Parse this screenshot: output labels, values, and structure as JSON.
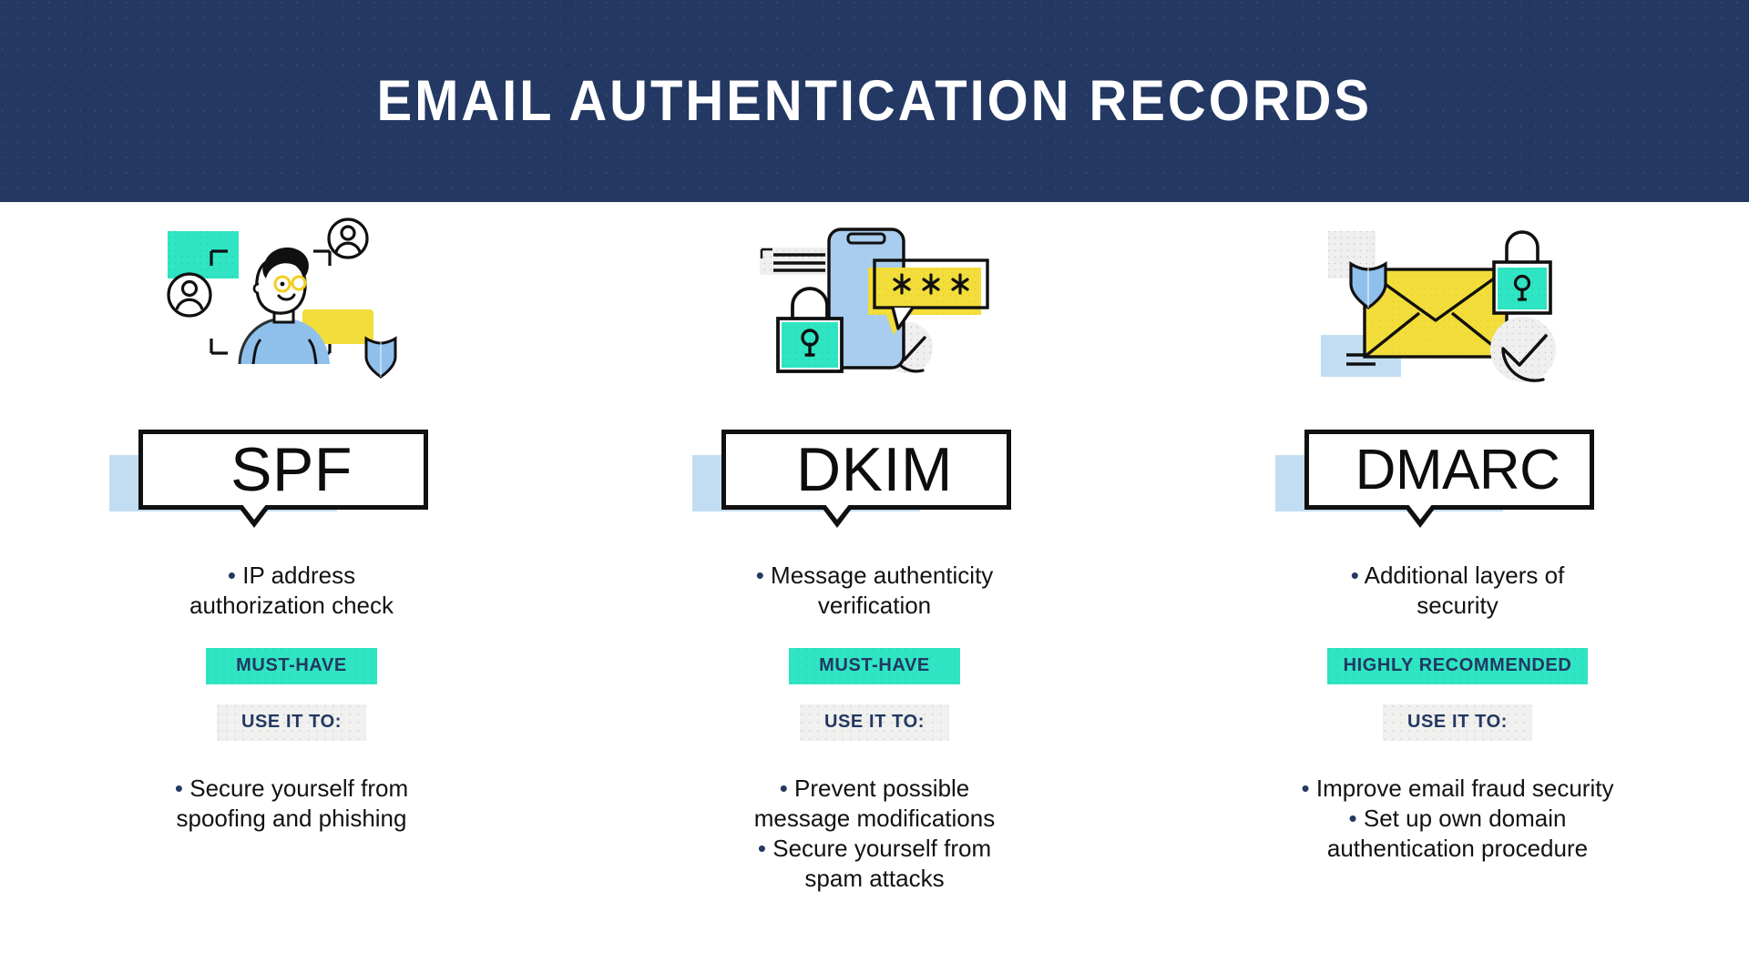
{
  "header": {
    "title": "EMAIL AUTHENTICATION RECORDS",
    "background_color": "#233862",
    "text_color": "#ffffff"
  },
  "palette": {
    "navy": "#233862",
    "mint": "#2fe5c3",
    "yellow": "#f2dd3a",
    "light_blue": "#c2ddf2",
    "sky_blue": "#8fc0ec",
    "light_gray": "#f0f0ee",
    "black": "#101010",
    "white": "#ffffff"
  },
  "columns": [
    {
      "id": "spf",
      "illustration_name": "person-identity-verification-illustration",
      "label": "SPF",
      "summary_bullet": "IP address",
      "summary_line2": "authorization check",
      "status_badge": "MUST-HAVE",
      "use_badge": "USE IT TO:",
      "uses": [
        {
          "line1": "Secure yourself from",
          "line2": "spoofing and phishing"
        }
      ]
    },
    {
      "id": "dkim",
      "illustration_name": "phone-password-lock-illustration",
      "label": "DKIM",
      "summary_bullet": "Message authenticity",
      "summary_line2": "verification",
      "status_badge": "MUST-HAVE",
      "use_badge": "USE IT TO:",
      "uses": [
        {
          "line1": "Prevent possible",
          "line2": "message modifications"
        },
        {
          "line1": "Secure yourself from",
          "line2": "spam attacks"
        }
      ]
    },
    {
      "id": "dmarc",
      "illustration_name": "envelope-lock-shield-illustration",
      "label": "DMARC",
      "summary_bullet": "Additional layers of",
      "summary_line2": "security",
      "status_badge": "HIGHLY RECOMMENDED",
      "use_badge": "USE IT TO:",
      "uses": [
        {
          "line1": "Improve email fraud security",
          "line2": ""
        },
        {
          "line1": "Set up own domain",
          "line2": "authentication procedure"
        }
      ]
    }
  ],
  "bullet_glyph": "•"
}
